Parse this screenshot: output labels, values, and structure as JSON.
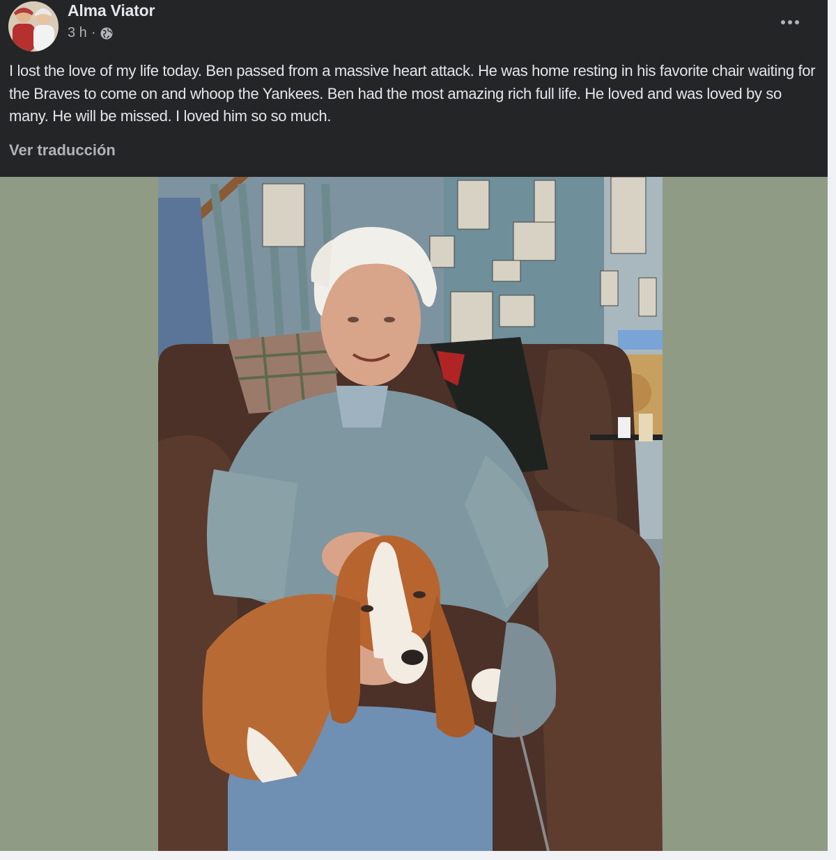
{
  "post": {
    "author": "Alma Viator",
    "time": "3 h",
    "separator": "·",
    "audience_icon": "globe-icon",
    "caption": "I lost the love of my life today. Ben passed from a massive heart attack. He was home resting in his favorite chair waiting for the Braves to come on and whoop the Yankees. Ben had the most amazing rich full life. He loved and was loved by so many. He will be missed. I loved him so so much.",
    "translate_label": "Ver traducción",
    "more_icon": "more-options-icon"
  },
  "colors": {
    "background": "#242526",
    "text_primary": "#e4e6eb",
    "text_secondary": "#b0b3b8",
    "media_backdrop": "#8f9b85"
  }
}
